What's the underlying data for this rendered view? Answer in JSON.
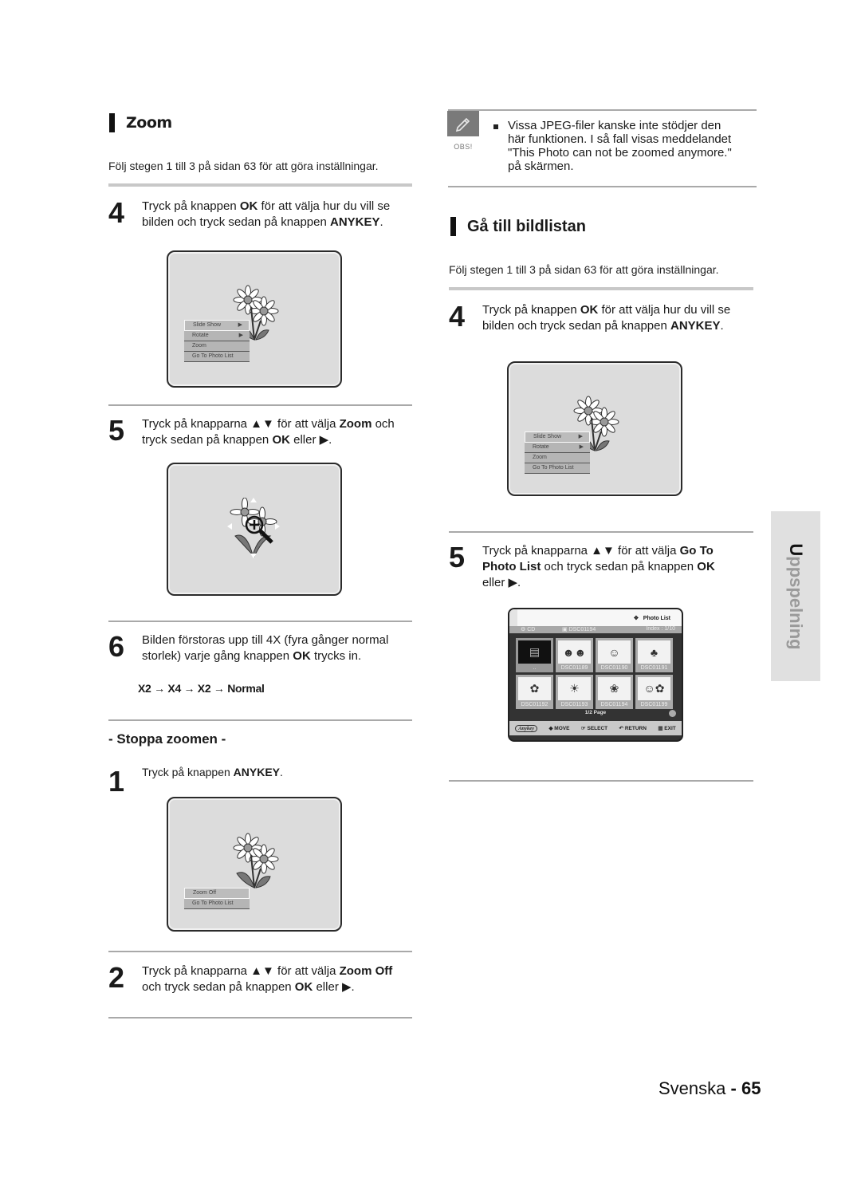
{
  "left": {
    "zoom_section": {
      "title": "Zoom",
      "intro": "Följ stegen 1 till 3 på sidan 63 för att göra inställningar.",
      "step4": {
        "num": "4",
        "line1_a": "Tryck på knappen ",
        "line1_b": "OK",
        "line1_c": " för att välja hur du vill se",
        "line2_a": "bilden och tryck sedan på knappen ",
        "line2_b": "ANYKEY",
        "line2_c": "."
      },
      "screen1_menu": [
        {
          "label": "Slide Show",
          "arrow": "▶",
          "selected": true
        },
        {
          "label": "Rotate",
          "arrow": "▶",
          "selected": false
        },
        {
          "label": "Zoom",
          "arrow": "",
          "selected": false
        },
        {
          "label": "Go To Photo List",
          "arrow": "",
          "selected": false
        }
      ],
      "step5": {
        "num": "5",
        "line1_a": "Tryck på knapparna ▲▼ för att välja ",
        "line1_b": "Zoom",
        "line1_c": " och",
        "line2_a": "tryck sedan på knappen ",
        "line2_b": "OK",
        "line2_c": " eller ▶."
      },
      "step6": {
        "num": "6",
        "line1": "Bilden förstoras upp till 4X (fyra gånger normal",
        "line2_a": "storlek) varje gång knappen ",
        "line2_b": "OK",
        "line2_c": " trycks in.",
        "sequence": "X2 → X4  → X2 → Normal"
      }
    },
    "stop_section": {
      "title": "- Stoppa zoomen -",
      "step1": {
        "num": "1",
        "text_a": "Tryck på knappen ",
        "text_b": "ANYKEY",
        "text_c": "."
      },
      "screen3_menu": [
        {
          "label": "Zoom Off",
          "selected": true
        },
        {
          "label": "Go To Photo List",
          "selected": false
        }
      ],
      "step2": {
        "num": "2",
        "line1_a": "Tryck på knapparna ▲▼ för att välja ",
        "line1_b": "Zoom Off",
        "line2_a": "och tryck sedan på knappen ",
        "line2_b": "OK",
        "line2_c": " eller ▶."
      }
    }
  },
  "right": {
    "note": {
      "label": "OBS!",
      "icon": "pencil-icon",
      "lines": [
        "Vissa JPEG-filer kanske inte stödjer den",
        "här funktionen. I så fall visas meddelandet",
        "\"This Photo can not be zoomed anymore.\"",
        "på skärmen."
      ]
    },
    "goto_section": {
      "title": "Gå till bildlistan",
      "intro": "Följ stegen 1 till 3 på sidan 63 för att göra inställningar.",
      "step4": {
        "num": "4",
        "line1_a": "Tryck på knappen ",
        "line1_b": "OK",
        "line1_c": " för att välja hur du vill se",
        "line2_a": "bilden och tryck sedan på knappen ",
        "line2_b": "ANYKEY",
        "line2_c": "."
      },
      "screen_menu": [
        {
          "label": "Slide Show",
          "arrow": "▶",
          "selected": true
        },
        {
          "label": "Rotate",
          "arrow": "▶",
          "selected": false
        },
        {
          "label": "Zoom",
          "arrow": "",
          "selected": false
        },
        {
          "label": "Go To Photo List",
          "arrow": "",
          "selected": false
        }
      ],
      "step5": {
        "num": "5",
        "line1_a": "Tryck på knapparna ▲▼ för att välja ",
        "line1_b": "Go To",
        "line2_a": "Photo List",
        "line2_b": " och tryck sedan på knappen ",
        "line2_c": "OK",
        "line3": "eller ▶."
      },
      "photo_list": {
        "title": "Photo List",
        "source": "CD",
        "current_file": "DSC01194",
        "index": "Index : 1/10",
        "thumbnails": [
          {
            "caption": "..",
            "kind": "folder"
          },
          {
            "caption": "DSC01189",
            "kind": "people"
          },
          {
            "caption": "DSC01190",
            "kind": "girl"
          },
          {
            "caption": "DSC01191",
            "kind": "tree"
          },
          {
            "caption": "DSC01192",
            "kind": "flower-dark"
          },
          {
            "caption": "DSC01193",
            "kind": "sun"
          },
          {
            "caption": "DSC01194",
            "kind": "flower-small"
          },
          {
            "caption": "DSC01199",
            "kind": "girl-flowers"
          }
        ],
        "page": "1/2 Page",
        "footer": {
          "anykey": "Anykey",
          "move": "MOVE",
          "select": "SELECT",
          "return": "RETURN",
          "exit": "EXIT"
        }
      }
    }
  },
  "side_tab": {
    "label": "Uppspelning"
  },
  "footer": {
    "language": "Svenska",
    "separator": " - ",
    "page_number": "65"
  }
}
